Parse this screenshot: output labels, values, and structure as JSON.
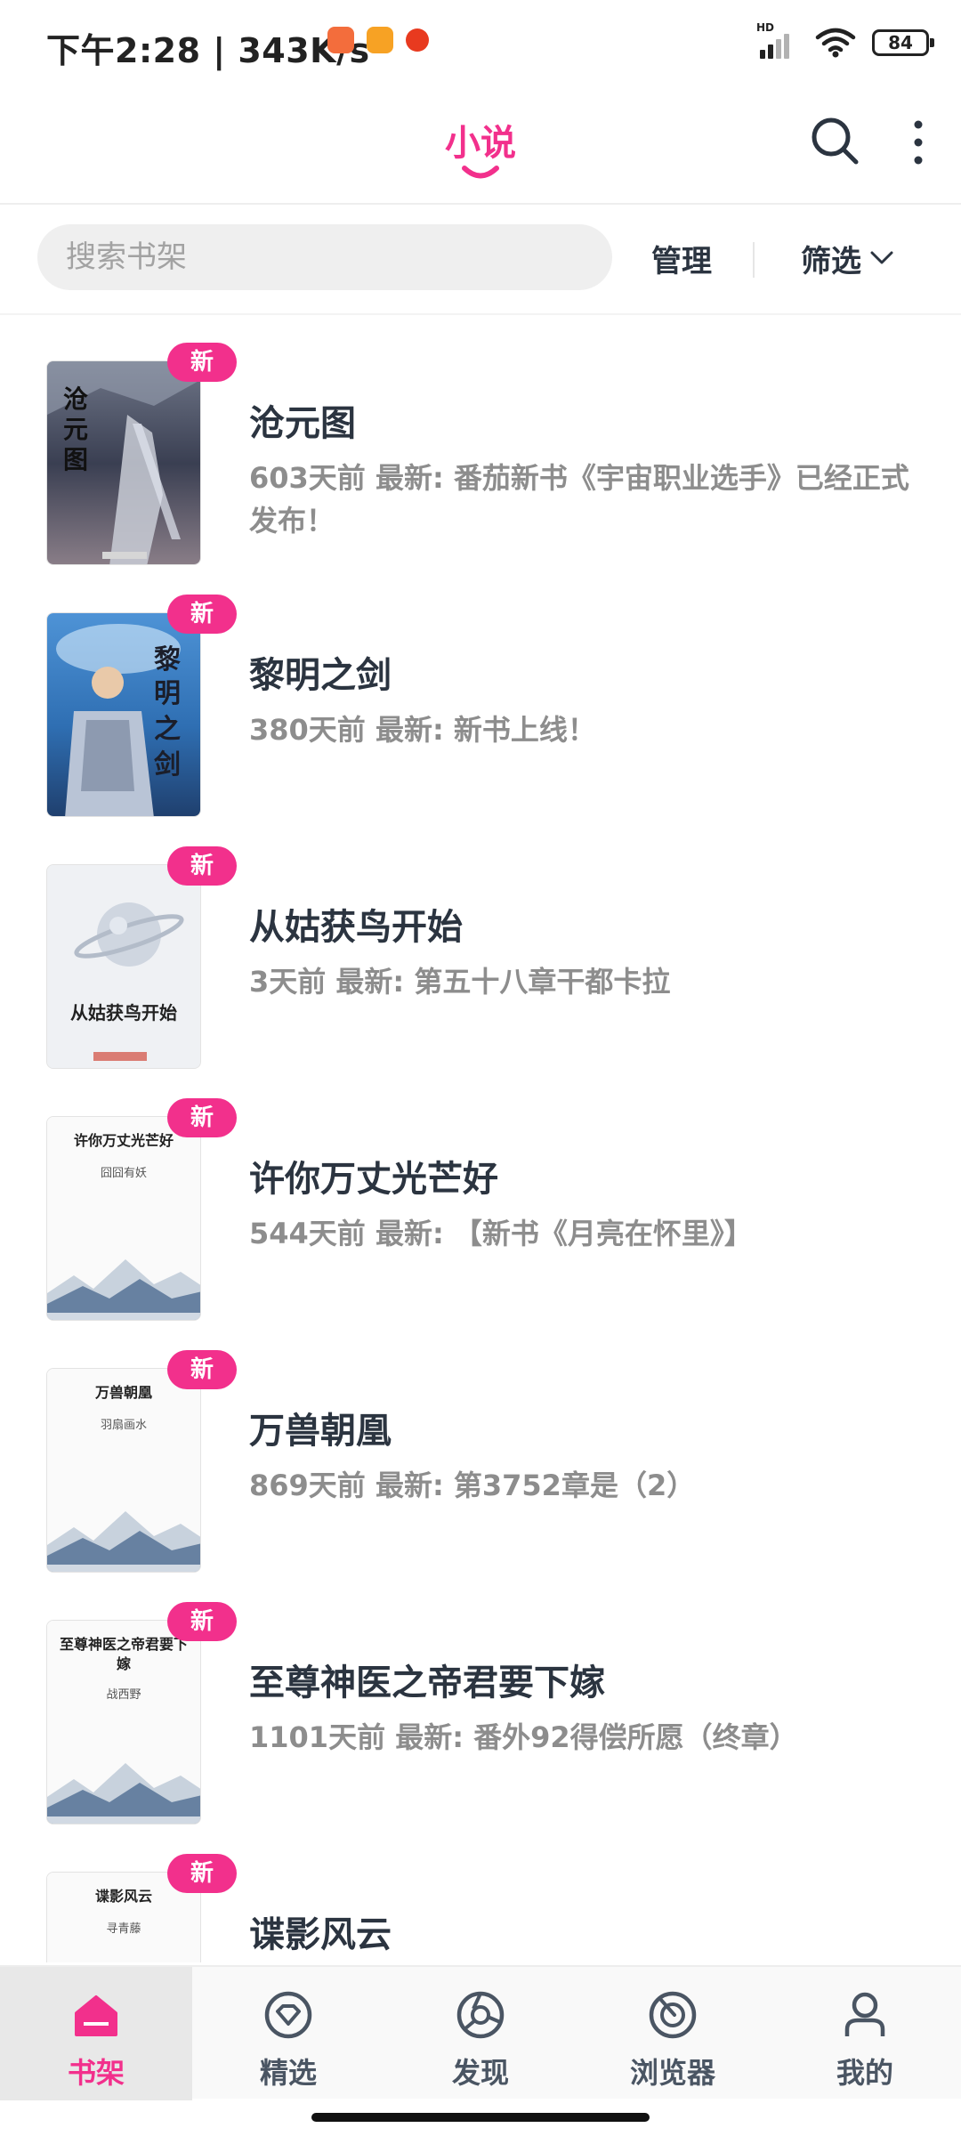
{
  "status_bar": {
    "time_speed": "下午2:28 | 343K/s",
    "hd_label": "HD",
    "battery": "84"
  },
  "header": {
    "brand": "小说"
  },
  "toolbar": {
    "search_placeholder": "搜索书架",
    "manage_label": "管理",
    "filter_label": "筛选"
  },
  "badge_new": "新",
  "books": [
    {
      "title": "沧元图",
      "meta": "603天前  最新: 番茄新书《宇宙职业选手》已经正式发布！"
    },
    {
      "title": "黎明之剑",
      "meta": "380天前  最新: 新书上线！"
    },
    {
      "title": "从姑获鸟开始",
      "meta": "3天前  最新: 第五十八章干都卡拉",
      "cover_title": "从姑获鸟开始"
    },
    {
      "title": "许你万丈光芒好",
      "meta": "544天前  最新: 【新书《月亮在怀里》】",
      "cover_title": "许你万丈光芒好",
      "cover_author": "囧囧有妖"
    },
    {
      "title": "万兽朝凰",
      "meta": "869天前  最新: 第3752章是（2）",
      "cover_title": "万兽朝凰",
      "cover_author": "羽扇画水"
    },
    {
      "title": "至尊神医之帝君要下嫁",
      "meta": "1101天前  最新: 番外92得偿所愿（终章）",
      "cover_title": "至尊神医之帝君要下嫁",
      "cover_author": "战西野"
    },
    {
      "title": "谍影风云",
      "meta": "",
      "cover_title": "谍影风云",
      "cover_author": "寻青藤"
    }
  ],
  "bottom_nav": [
    {
      "label": "书架",
      "icon": "bookshelf-home-icon",
      "active": true
    },
    {
      "label": "精选",
      "icon": "featured-icon"
    },
    {
      "label": "发现",
      "icon": "discover-icon"
    },
    {
      "label": "浏览器",
      "icon": "browser-icon"
    },
    {
      "label": "我的",
      "icon": "profile-icon"
    }
  ],
  "colors": {
    "accent": "#f2308c",
    "text_primary": "#2b3440",
    "text_secondary": "#8d8d8d"
  }
}
